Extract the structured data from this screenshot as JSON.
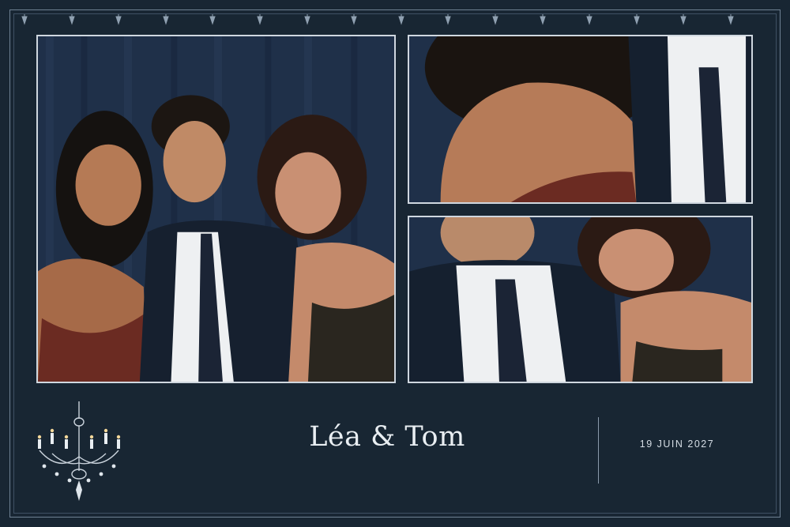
{
  "card": {
    "names": "Léa & Tom",
    "date": "19 JUIN 2027"
  },
  "photos": [
    {
      "id": "main",
      "subject": "three-guests-laughing-photo"
    },
    {
      "id": "top-right",
      "subject": "closeup-shoulders-photo"
    },
    {
      "id": "bottom-right",
      "subject": "couple-laughing-photo"
    }
  ],
  "ornament": {
    "icon": "chandelier-icon",
    "repeat_icon": "drop-ornament-icon"
  },
  "colors": {
    "background": "#182633",
    "frame": "#6f8193",
    "text": "#e9eef2",
    "curtain": "#1d2e44"
  }
}
